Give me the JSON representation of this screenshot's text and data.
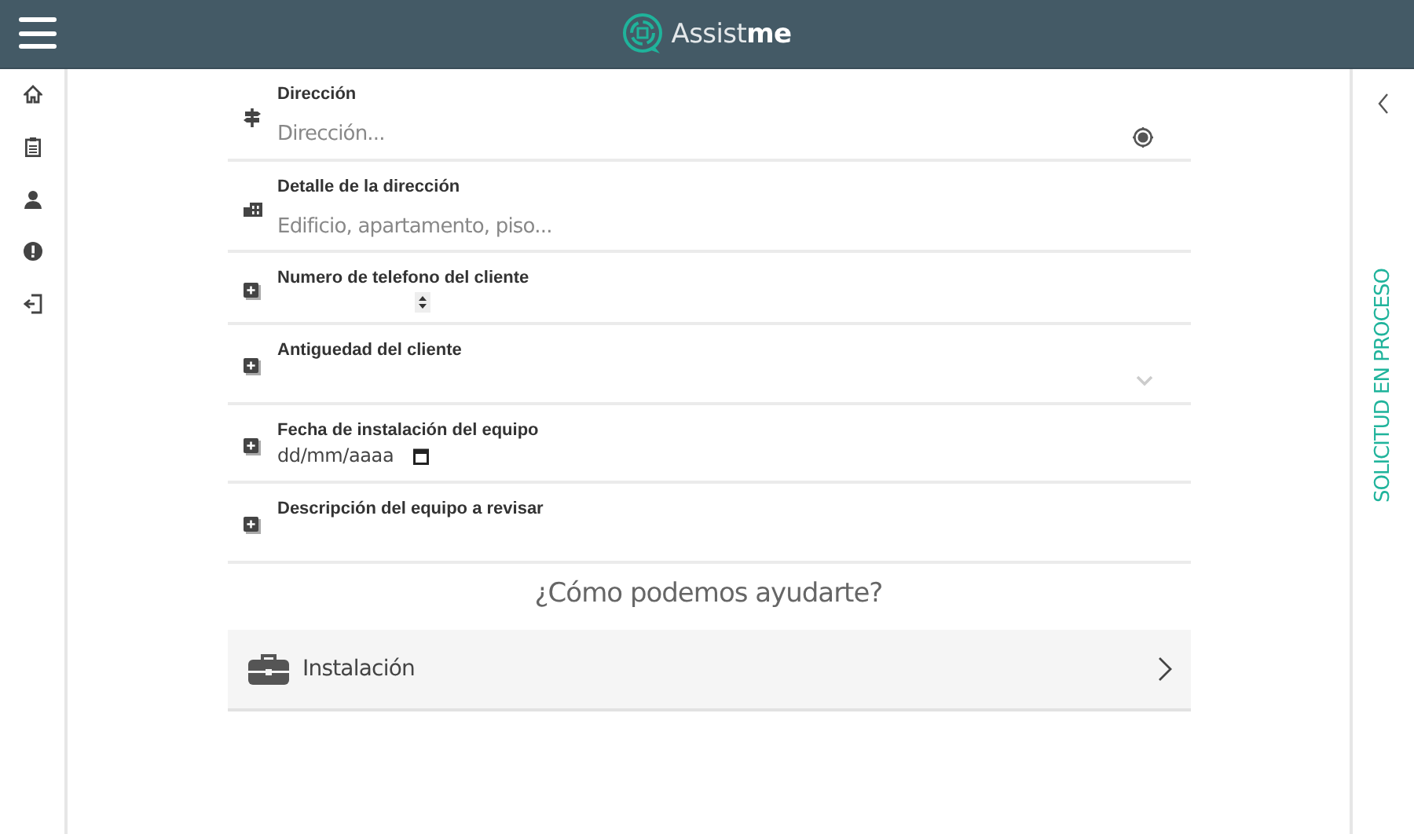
{
  "header": {
    "logo_text": "Assist",
    "logo_bold": "me"
  },
  "fields": [
    {
      "kind": "text",
      "label": "Dirección",
      "placeholder": "Dirección..."
    },
    {
      "kind": "text",
      "label": "Detalle de la dirección",
      "placeholder": "Edificio, apartamento, piso..."
    },
    {
      "kind": "number",
      "label": "Numero de telefono del cliente"
    },
    {
      "kind": "select",
      "label": "Antiguedad del cliente"
    },
    {
      "kind": "date",
      "label": "Fecha de instalación del equipo",
      "placeholder": "dd/mm/aaaa"
    },
    {
      "kind": "textarea",
      "label": "Descripción del equipo a revisar"
    }
  ],
  "help_title": "¿Cómo podemos ayudarte?",
  "options": [
    {
      "label": "Instalación"
    }
  ],
  "side_panel": {
    "title": "SOLICITUD EN PROCESO",
    "expanded": false
  }
}
